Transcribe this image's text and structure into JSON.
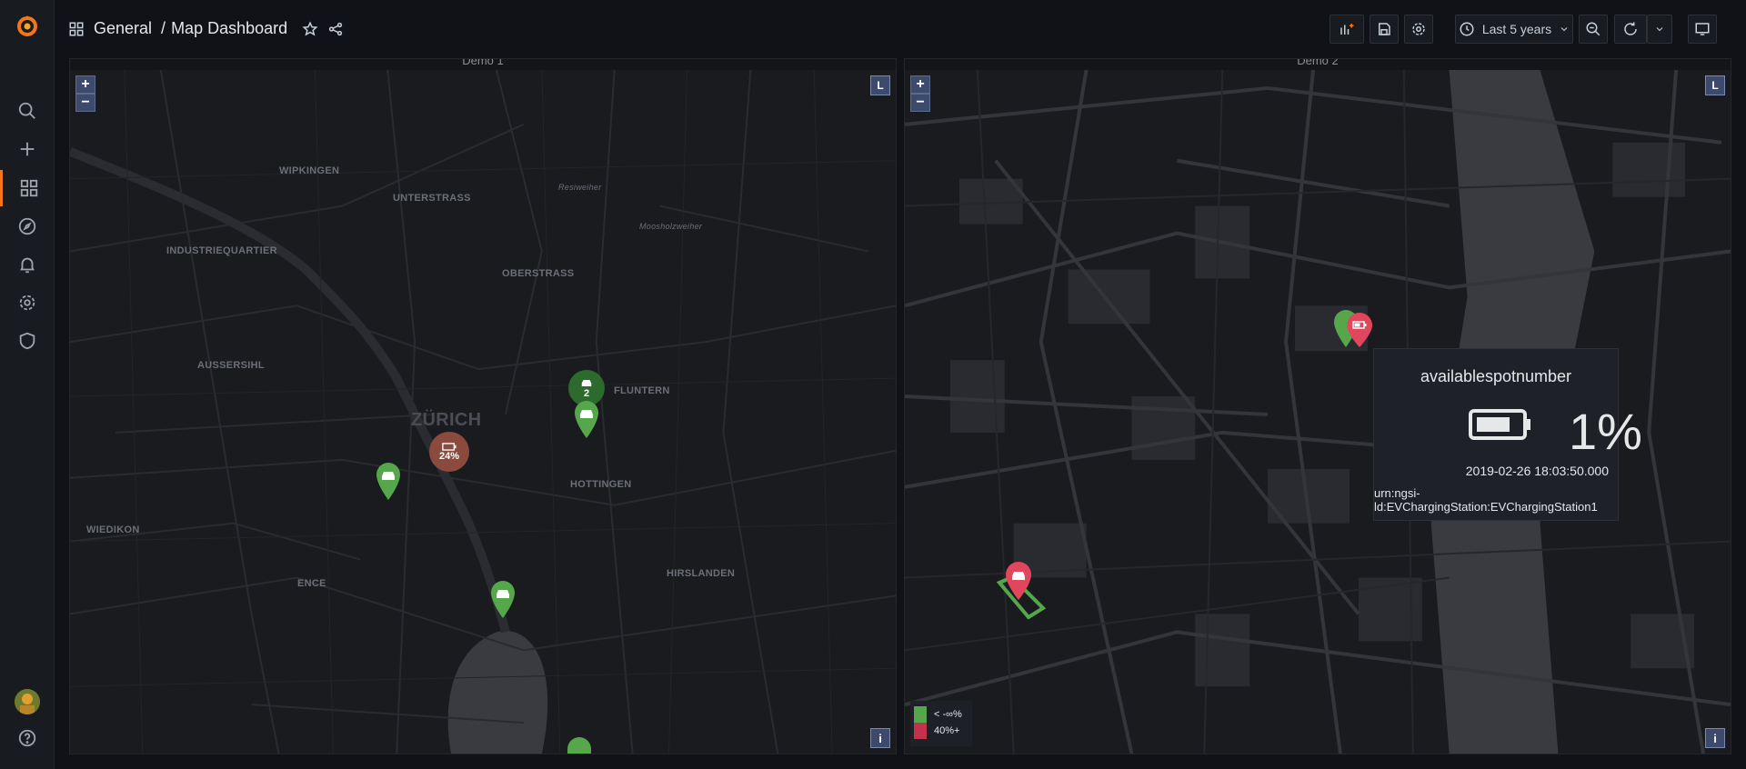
{
  "header": {
    "breadcrumb_folder": "General",
    "breadcrumb_sep": "/",
    "dashboard_title": "Map Dashboard",
    "time_range": "Last 5 years"
  },
  "panels": [
    {
      "title": "Demo 1",
      "zoom_in": "+",
      "zoom_out": "−",
      "layer_label": "L",
      "info_label": "i",
      "places": [
        "WIPKINGEN",
        "UNTERSTRASS",
        "INDUSTRIEQUARTIER",
        "OBERSTRASS",
        "AUSSERSIHL",
        "ZÜRICH",
        "FLUNTERN",
        "HOTTINGEN",
        "WIEDIKON",
        "ENCE",
        "HIRSLANDEN",
        "Resiweiher",
        "Moosholzweiher"
      ],
      "markers": [
        {
          "label": "2",
          "color": "#2d6a2d"
        },
        {
          "label": "24%",
          "color": "#8a4a3e"
        }
      ]
    },
    {
      "title": "Demo 2",
      "zoom_in": "+",
      "zoom_out": "−",
      "layer_label": "L",
      "info_label": "i",
      "legend": [
        {
          "label": "< -∞%",
          "color": "#56a64b"
        },
        {
          "label": "40%+",
          "color": "#c4314b"
        }
      ]
    }
  ],
  "tooltip": {
    "title": "availablespotnumber",
    "value": "1%",
    "datetime": "2019-02-26 18:03:50.000",
    "id": "urn:ngsi-ld:EVChargingStation:EVChargingStation1"
  },
  "colors": {
    "accent": "#f5761a",
    "marker_green": "#56a64b",
    "marker_red": "#e0475c"
  }
}
